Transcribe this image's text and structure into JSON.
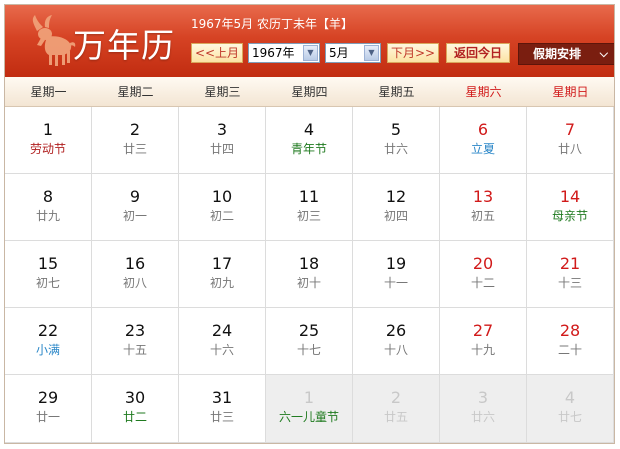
{
  "app": {
    "title": "万年历",
    "header_info": "1967年5月 农历丁未年【羊】"
  },
  "controls": {
    "prev_label": "<<上月",
    "next_label": "下月>>",
    "today_label": "返回今日",
    "holiday_label": "假期安排",
    "year_value": "1967年",
    "month_value": "5月"
  },
  "weekdays": [
    "星期一",
    "星期二",
    "星期三",
    "星期四",
    "星期五",
    "星期六",
    "星期日"
  ],
  "weeks": [
    [
      {
        "day": "1",
        "sub": "劳动节",
        "type": "festival"
      },
      {
        "day": "2",
        "sub": "廿三",
        "type": "lunar"
      },
      {
        "day": "3",
        "sub": "廿四",
        "type": "lunar"
      },
      {
        "day": "4",
        "sub": "青年节",
        "type": "holiday"
      },
      {
        "day": "5",
        "sub": "廿六",
        "type": "lunar"
      },
      {
        "day": "6",
        "sub": "立夏",
        "type": "term"
      },
      {
        "day": "7",
        "sub": "廿八",
        "type": "lunar"
      }
    ],
    [
      {
        "day": "8",
        "sub": "廿九",
        "type": "lunar"
      },
      {
        "day": "9",
        "sub": "初一",
        "type": "lunar"
      },
      {
        "day": "10",
        "sub": "初二",
        "type": "lunar"
      },
      {
        "day": "11",
        "sub": "初三",
        "type": "lunar"
      },
      {
        "day": "12",
        "sub": "初四",
        "type": "lunar"
      },
      {
        "day": "13",
        "sub": "初五",
        "type": "lunar"
      },
      {
        "day": "14",
        "sub": "母亲节",
        "type": "holiday"
      }
    ],
    [
      {
        "day": "15",
        "sub": "初七",
        "type": "lunar"
      },
      {
        "day": "16",
        "sub": "初八",
        "type": "lunar"
      },
      {
        "day": "17",
        "sub": "初九",
        "type": "lunar"
      },
      {
        "day": "18",
        "sub": "初十",
        "type": "lunar"
      },
      {
        "day": "19",
        "sub": "十一",
        "type": "lunar"
      },
      {
        "day": "20",
        "sub": "十二",
        "type": "lunar"
      },
      {
        "day": "21",
        "sub": "十三",
        "type": "lunar"
      }
    ],
    [
      {
        "day": "22",
        "sub": "小满",
        "type": "term"
      },
      {
        "day": "23",
        "sub": "十五",
        "type": "lunar"
      },
      {
        "day": "24",
        "sub": "十六",
        "type": "lunar"
      },
      {
        "day": "25",
        "sub": "十七",
        "type": "lunar"
      },
      {
        "day": "26",
        "sub": "十八",
        "type": "lunar"
      },
      {
        "day": "27",
        "sub": "十九",
        "type": "lunar"
      },
      {
        "day": "28",
        "sub": "二十",
        "type": "lunar"
      }
    ],
    [
      {
        "day": "29",
        "sub": "廿一",
        "type": "lunar"
      },
      {
        "day": "30",
        "sub": "廿二",
        "type": "holiday"
      },
      {
        "day": "31",
        "sub": "廿三",
        "type": "lunar"
      },
      {
        "day": "1",
        "sub": "六一儿童节",
        "type": "holiday",
        "other": true
      },
      {
        "day": "2",
        "sub": "廿五",
        "type": "lunar",
        "other": true
      },
      {
        "day": "3",
        "sub": "廿六",
        "type": "lunar",
        "other": true
      },
      {
        "day": "4",
        "sub": "廿七",
        "type": "lunar",
        "other": true
      }
    ]
  ],
  "colors": {
    "header_red": "#c12c10",
    "weekend_red": "#d11a1a",
    "holiday_green": "#1f7a1f",
    "term_blue": "#2b87c8",
    "festival_red": "#b01e1e"
  }
}
